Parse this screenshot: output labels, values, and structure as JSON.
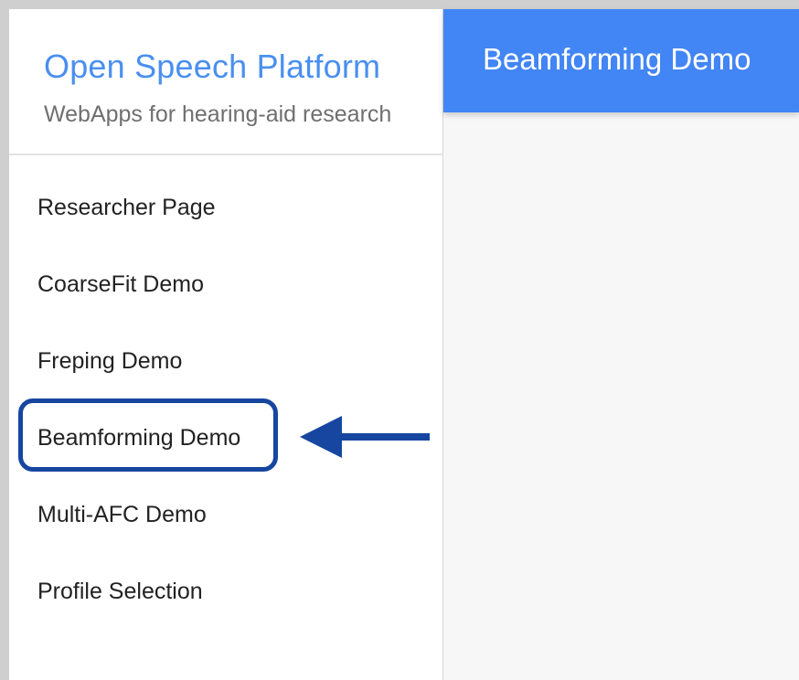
{
  "sidebar": {
    "brand_title": "Open Speech Platform",
    "brand_subtitle": "WebApps for hearing-aid research",
    "items": [
      {
        "label": "Researcher Page"
      },
      {
        "label": "CoarseFit Demo"
      },
      {
        "label": "Freping Demo"
      },
      {
        "label": "Beamforming Demo"
      },
      {
        "label": "Multi-AFC Demo"
      },
      {
        "label": "Profile Selection"
      }
    ],
    "highlighted_item": "Beamforming Demo"
  },
  "header": {
    "title": "Beamforming Demo"
  },
  "colors": {
    "brand_blue": "#4a8ff0",
    "header_blue": "#4285f4",
    "highlight_navy": "#1646a0",
    "main_background": "#f7f7f7"
  },
  "icons": {
    "annotation": "left-arrow-icon"
  }
}
